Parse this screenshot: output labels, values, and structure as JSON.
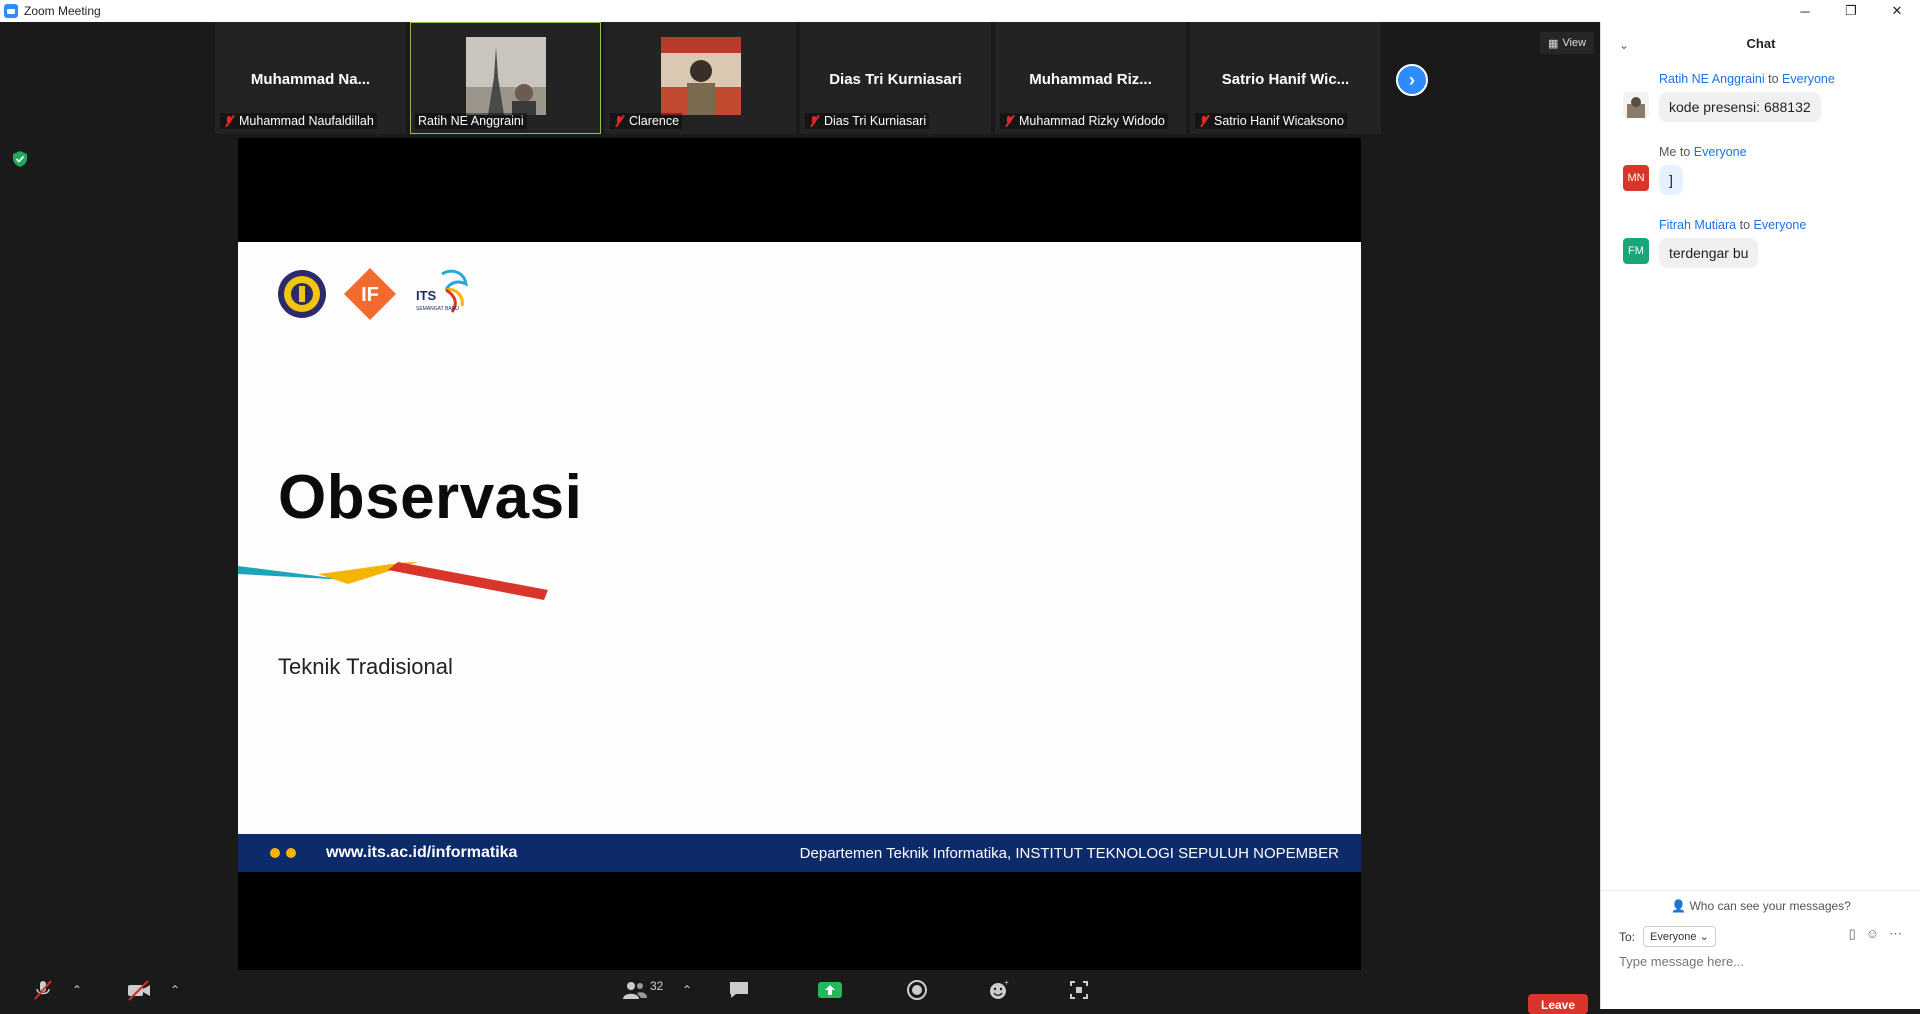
{
  "window": {
    "title": "Zoom Meeting",
    "minimize": "─",
    "restore": "❐",
    "close": "✕"
  },
  "participants": [
    {
      "display_name": "Muhammad  Na...",
      "name": "Muhammad Naufaldillah",
      "video": false
    },
    {
      "display_name": "",
      "name": "Ratih NE Anggraini",
      "video": true,
      "active": true
    },
    {
      "display_name": "",
      "name": "Clarence",
      "video": true
    },
    {
      "display_name": "Dias Tri Kurniasari",
      "name": "Dias Tri Kurniasari",
      "video": false
    },
    {
      "display_name": "Muhammad  Riz...",
      "name": "Muhammad Rizky Widodo",
      "video": false
    },
    {
      "display_name": "Satrio  Hanif  Wic...",
      "name": "Satrio Hanif Wicaksono",
      "video": false
    }
  ],
  "view_button": "View",
  "slide": {
    "title": "Observasi",
    "subtitle": "Teknik Tradisional",
    "footer_url": "www.its.ac.id/informatika",
    "footer_dept": "Departemen Teknik Informatika, INSTITUT TEKNOLOGI SEPULUH NOPEMBER",
    "logo_if": "IF",
    "logo_its": "ITS",
    "logo_its_tag": "SEMANGAT BARU"
  },
  "toolbar": {
    "participants_count": "32",
    "leave_label": "Leave"
  },
  "chat": {
    "title": "Chat",
    "messages": [
      {
        "sender": "Ratih NE Anggraini",
        "to_word": "to",
        "recipient": "Everyone",
        "text": "kode presensi: 688132",
        "avatar": "",
        "avatar_color": "#8a7b6a"
      },
      {
        "sender": "Me",
        "to_word": "to",
        "recipient": "Everyone",
        "text": "]",
        "avatar": "MN",
        "avatar_color": "#d9352a"
      },
      {
        "sender": "Fitrah Mutiara",
        "to_word": "to",
        "recipient": "Everyone",
        "text": "terdengar bu",
        "avatar": "FM",
        "avatar_color": "#1aa57a"
      }
    ],
    "who_can_see": "Who can see your messages?",
    "to_label": "To:",
    "to_value": "Everyone",
    "placeholder": "Type message here..."
  }
}
